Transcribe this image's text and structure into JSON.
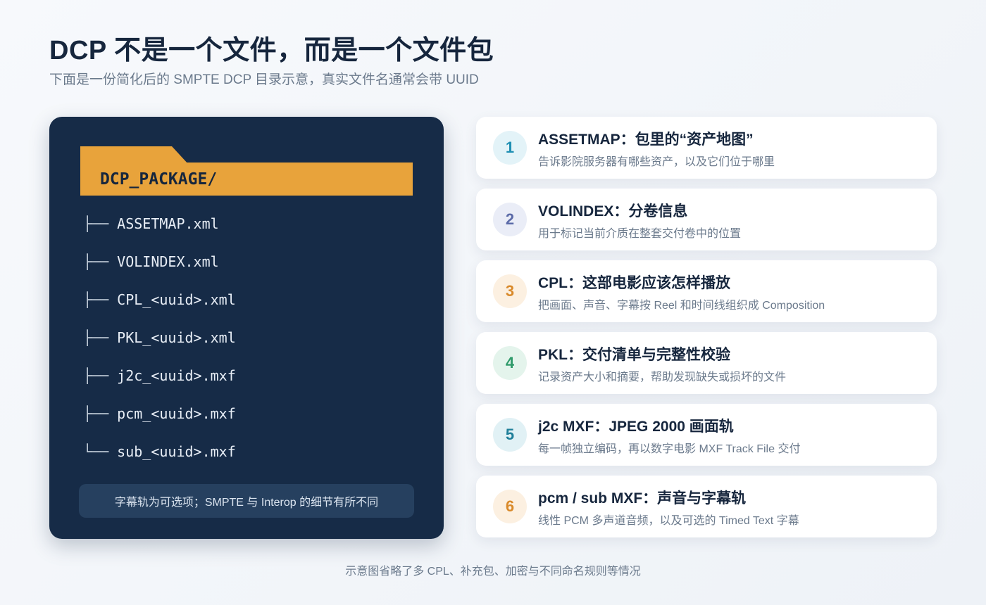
{
  "header": {
    "title": "DCP 不是一个文件，而是一个文件包",
    "subtitle": "下面是一份简化后的 SMPTE DCP 目录示意，真实文件名通常会带 UUID"
  },
  "tree": {
    "folder": "DCP_PACKAGE/",
    "items": [
      {
        "branch": "├──",
        "name": "ASSETMAP.xml"
      },
      {
        "branch": "├──",
        "name": "VOLINDEX.xml"
      },
      {
        "branch": "├──",
        "name": "CPL_<uuid>.xml"
      },
      {
        "branch": "├──",
        "name": "PKL_<uuid>.xml"
      },
      {
        "branch": "├──",
        "name": "j2c_<uuid>.mxf"
      },
      {
        "branch": "├──",
        "name": "pcm_<uuid>.mxf"
      },
      {
        "branch": "└──",
        "name": "sub_<uuid>.mxf"
      }
    ],
    "note": "字幕轨为可选项；SMPTE 与 Interop 的细节有所不同"
  },
  "cards": [
    {
      "num": "1",
      "title": "ASSETMAP：包里的“资产地图”",
      "desc": "告诉影院服务器有哪些资产，以及它们位于哪里",
      "color": "#1f8fb3",
      "bg": "#e3f3f8"
    },
    {
      "num": "2",
      "title": "VOLINDEX：分卷信息",
      "desc": "用于标记当前介质在整套交付卷中的位置",
      "color": "#5b6aa8",
      "bg": "#eaedf7"
    },
    {
      "num": "3",
      "title": "CPL：这部电影应该怎样播放",
      "desc": "把画面、声音、字幕按 Reel 和时间线组织成 Composition",
      "color": "#d98a2b",
      "bg": "#fcf0e1"
    },
    {
      "num": "4",
      "title": "PKL：交付清单与完整性校验",
      "desc": "记录资产大小和摘要，帮助发现缺失或损坏的文件",
      "color": "#2f9a6a",
      "bg": "#e4f4ec"
    },
    {
      "num": "5",
      "title": "j2c MXF：JPEG 2000 画面轨",
      "desc": "每一帧独立编码，再以数字电影 MXF Track File 交付",
      "color": "#1f7f99",
      "bg": "#e1f1f5"
    },
    {
      "num": "6",
      "title": "pcm / sub MXF：声音与字幕轨",
      "desc": "线性 PCM 多声道音频，以及可选的 Timed Text 字幕",
      "color": "#d98a2b",
      "bg": "#fcf0e1"
    }
  ],
  "footer": "示意图省略了多 CPL、补充包、加密与不同命名规则等情况"
}
